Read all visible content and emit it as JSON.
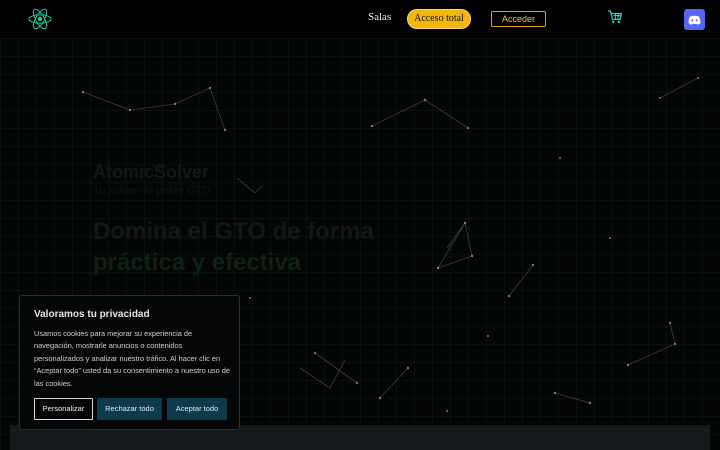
{
  "header": {
    "logo_icon": "atom-icon",
    "nav_salas": "Salas",
    "access_button": "Acceso total",
    "login_button": "Acceder",
    "cart_icon": "cart-icon",
    "discord_icon": "discord-icon",
    "accent_color": "#f2b70e"
  },
  "hero": {
    "brand": "AtomicSolver",
    "subtitle": "Tu solver de poker GTO",
    "title_part1": "Domina el GTO de forma",
    "title_part2": "práctica y efectiva"
  },
  "cookie_banner": {
    "title": "Valoramos tu privacidad",
    "text": "Usamos cookies para mejorar su experiencia de navegación, mostrarle anuncios o contenidos personalizados y analizar nuestro tráfico. Al hacer clic en “Aceptar todo” usted da su consentimiento a nuestro uso de las cookies.",
    "customize_button": "Personalizar",
    "reject_button": "Rechazar todo",
    "accept_button": "Aceptar todo",
    "button_color": "#0d3b4c"
  }
}
